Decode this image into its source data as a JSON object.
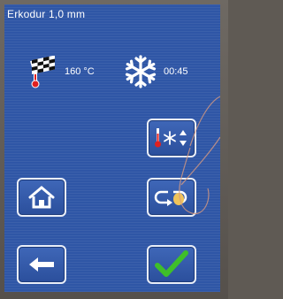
{
  "screen": {
    "title": "Erkodur 1,0 mm",
    "temperature": "160 °C",
    "time": "00:45"
  },
  "icons": {
    "heat": "checkered-flag-thermometer-icon",
    "cool": "snowflake-icon"
  },
  "buttons": {
    "cool_settings": "thermometer-snowflake-updown-icon",
    "scan": "scan-cycle-icon",
    "home": "home-icon",
    "back": "arrow-left-icon",
    "confirm": "checkmark-icon"
  },
  "colors": {
    "screen_bg": "#2f56a6",
    "text": "#ffffff",
    "accent_red": "#e02020",
    "confirm_green": "#3fbf2a"
  }
}
